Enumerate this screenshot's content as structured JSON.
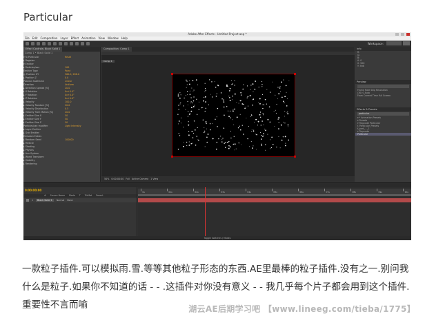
{
  "post": {
    "title": "Particular",
    "description": "一款粒子插件.可以模拟雨.雪.等等其他粒子形态的东西.AE里最棒的粒子插件.没有之一.别问我什么是粒子.如果你不知道的话 - - .这插件对你没有意义 - - 我几乎每个片子都会用到这个插件.重要性不言而喻",
    "watermark": "湖云AE后期学习吧 【www.lineeg.com/tieba/1775】"
  },
  "ae": {
    "window_title": "Adobe After Effects - Untitled Project.aep *",
    "menus": [
      "File",
      "Edit",
      "Composition",
      "Layer",
      "Effect",
      "Animation",
      "View",
      "Window",
      "Help"
    ],
    "workspace_label": "Workspace:",
    "workspace_value": "Standard",
    "effect_panel": {
      "tab": "Effect Controls: Black Solid 1",
      "header": "Comp 1 • Black Solid 1",
      "rows": [
        {
          "label": "▾ fx Particular",
          "value": "Reset"
        },
        {
          "label": "  ▸ Register",
          "value": ""
        },
        {
          "label": "  ▾ Emitter",
          "value": ""
        },
        {
          "label": "    ▸ Particles/sec",
          "value": "100"
        },
        {
          "label": "      Emitter Type",
          "value": "Point"
        },
        {
          "label": "    ◎ Position XY",
          "value": "360.0, 288.0"
        },
        {
          "label": "    ▸ Position Z",
          "value": "0.0"
        },
        {
          "label": "      Position Subframe",
          "value": "Linear"
        },
        {
          "label": "      Direction",
          "value": "Uniform"
        },
        {
          "label": "    ▸ Direction Spread [%]",
          "value": "20.0"
        },
        {
          "label": "    ▸ X Rotation",
          "value": "0x+0.0°"
        },
        {
          "label": "    ▸ Y Rotation",
          "value": "0x+0.0°"
        },
        {
          "label": "    ▸ Z Rotation",
          "value": "0x+0.0°"
        },
        {
          "label": "    ▸ Velocity",
          "value": "100.0"
        },
        {
          "label": "    ▸ Velocity Random [%]",
          "value": "20.0"
        },
        {
          "label": "    ▸ Velocity Distribution",
          "value": "0.5"
        },
        {
          "label": "    ▸ Velocity from Motion [%]",
          "value": "20.0"
        },
        {
          "label": "    ▸ Emitter Size X",
          "value": "50"
        },
        {
          "label": "    ▸ Emitter Size Y",
          "value": "50"
        },
        {
          "label": "    ▸ Emitter Size Z",
          "value": "50"
        },
        {
          "label": "      Particles/sec modifier",
          "value": "Light Intensity"
        },
        {
          "label": "    ▸ Layer Emitter",
          "value": ""
        },
        {
          "label": "    ▸ Grid Emitter",
          "value": ""
        },
        {
          "label": "      Emission Extras",
          "value": ""
        },
        {
          "label": "    ▸ Random Seed",
          "value": "100000"
        },
        {
          "label": "  ▸ Particle",
          "value": ""
        },
        {
          "label": "  ▸ Shading",
          "value": ""
        },
        {
          "label": "  ▸ Physics",
          "value": ""
        },
        {
          "label": "  ▸ Aux System",
          "value": ""
        },
        {
          "label": "  ▸ World Transform",
          "value": ""
        },
        {
          "label": "  ▸ Visibility",
          "value": ""
        },
        {
          "label": "  ▸ Rendering",
          "value": ""
        }
      ]
    },
    "comp_panel": {
      "tab": "Composition: Comp 1",
      "sub_tab": "Comp 1",
      "footer": [
        "50%",
        "0:00:00:00",
        "Full",
        "Active Camera",
        "1 View"
      ]
    },
    "right_panel": {
      "info_title": "Info",
      "info_lines": [
        "R:",
        "G:",
        "B:",
        "A: 0",
        "X: 506",
        "Y: 598"
      ],
      "preview_title": "Preview",
      "preview_lines": [
        "Frame Rate   Skip   Resolution",
        "(30)   0   Auto",
        "From Current Time   Full Screen"
      ],
      "effects_title": "Effects & Presets",
      "effects_search": "particular",
      "effects_lines": [
        "▾ * Animation Presets",
        "  ▾ Presets",
        "    ▾ Trapcode Particular",
        "      t_Particular_Presets",
        "      t_part_..._1",
        "▾ Trapcode",
        "    Particular"
      ]
    },
    "timeline": {
      "tab": "Comp 1",
      "timecode": "0:00:00:00",
      "headers": [
        "#",
        "Source Name",
        "Mode",
        "T",
        "TrkMat",
        "Parent"
      ],
      "layer_number": "1",
      "layer_name": "Black Solid 1",
      "layer_mode": "Normal",
      "layer_parent": "None",
      "ruler": [
        "0s",
        "01s",
        "02s",
        "03s",
        "04s",
        "05s",
        "06s",
        "07s",
        "08s",
        "09s",
        "10s"
      ],
      "footer": "Toggle Switches / Modes"
    }
  }
}
